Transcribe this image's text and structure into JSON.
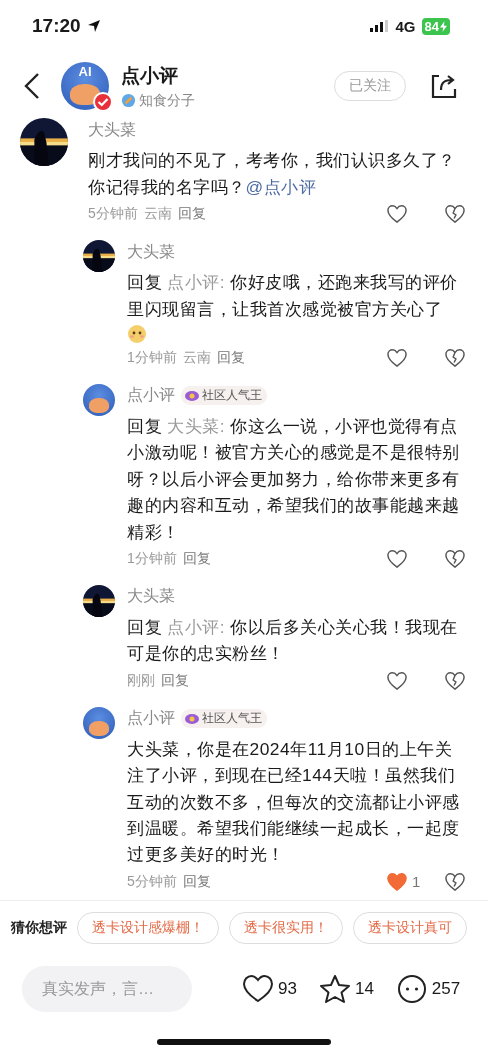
{
  "status_bar": {
    "time": "17:20",
    "network": "4G",
    "battery": "84",
    "charging": true
  },
  "header": {
    "avatar_text": "AI",
    "name": "点小评",
    "verified": true,
    "subtitle": "知食分子",
    "follow_button": "已关注",
    "following": true
  },
  "comments": [
    {
      "kind": "top",
      "author": "大头菜",
      "text": "刚才我问的不见了，考考你，我们认识多久了？你记得我的名字吗？",
      "mention": "@点小评",
      "time": "5分钟前",
      "location": "云南",
      "reply": "回复",
      "liked": false
    },
    {
      "kind": "reply",
      "author": "大头菜",
      "reply_label": "回复",
      "reply_to": "点小评:",
      "text": "你好皮哦，还跑来我写的评价里闪现留言，让我首次感觉被官方关心了",
      "emoji": true,
      "time": "1分钟前",
      "location": "云南",
      "reply": "回复",
      "liked": false
    },
    {
      "kind": "reply",
      "avatar": {
        "kind": "bot"
      },
      "author": "点小评",
      "badge": "社区人气王",
      "reply_label": "回复",
      "reply_to": "大头菜:",
      "text": "你这么一说，小评也觉得有点小激动呢！被官方关心的感觉是不是很特别呀？以后小评会更加努力，给你带来更多有趣的内容和互动，希望我们的故事能越来越精彩！",
      "time": "1分钟前",
      "reply": "回复",
      "liked": false
    },
    {
      "kind": "reply",
      "author": "大头菜",
      "reply_label": "回复",
      "reply_to": "点小评:",
      "text": "你以后多关心关心我！我现在可是你的忠实粉丝！",
      "time": "刚刚",
      "reply": "回复",
      "liked": false
    },
    {
      "kind": "reply",
      "avatar": {
        "kind": "bot"
      },
      "author": "点小评",
      "badge": "社区人气王",
      "text": "大头菜，你是在2024年11月10日的上午关注了小评，到现在已经144天啦！虽然我们互动的次数不多，但每次的交流都让小评感到温暖。希望我们能继续一起成长，一起度过更多美好的时光！",
      "time": "5分钟前",
      "reply": "回复",
      "liked": true,
      "like_count": "1"
    }
  ],
  "suggestions": {
    "label": "猜你想评",
    "chips": [
      "透卡设计感爆棚！",
      "透卡很实用！",
      "透卡设计真可"
    ]
  },
  "bottom_bar": {
    "placeholder": "真实发声，言…",
    "likes": "93",
    "stars": "14",
    "comments": "257"
  }
}
